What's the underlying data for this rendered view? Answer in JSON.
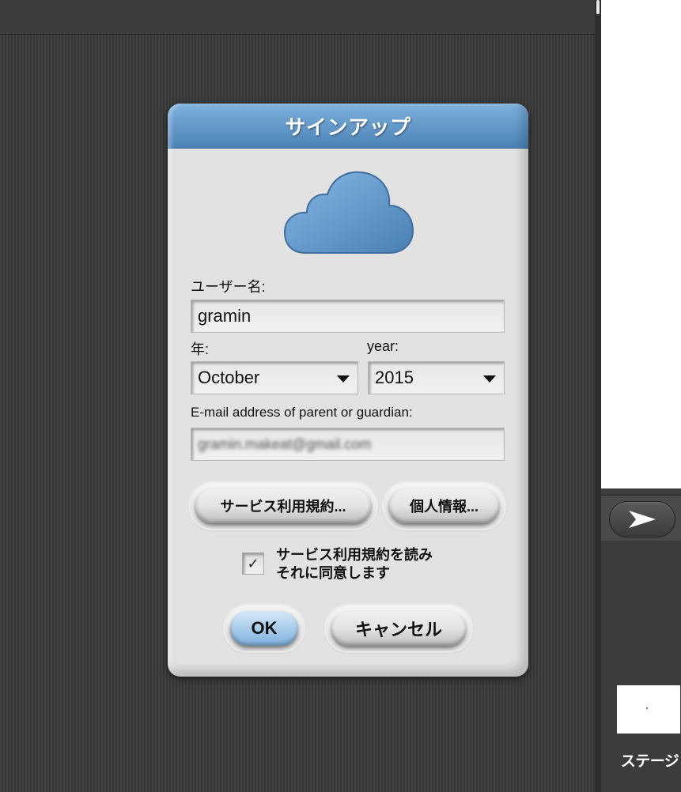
{
  "dialog": {
    "title": "サインアップ",
    "username_label": "ユーザー名:",
    "username_value": "gramin",
    "month_label": "年:",
    "month_value": "October",
    "year_label": "year:",
    "year_value": "2015",
    "email_label": "E-mail address of parent or guardian:",
    "email_value": "gramin.makeat@gmail.com",
    "terms_button": "サービス利用規約...",
    "privacy_button": "個人情報...",
    "agree_line1": "サービス利用規約を読み",
    "agree_line2": "それに同意します",
    "agree_checked": true,
    "check_glyph": "✓",
    "ok_button": "OK",
    "cancel_button": "キャンセル"
  },
  "stage": {
    "label": "ステージ"
  },
  "colors": {
    "header_top": "#7fb1dd",
    "header_bottom": "#4b82b6",
    "cloud": "#5d96cb"
  },
  "icons": {
    "cloud": "cloud-icon",
    "dropdown": "chevron-down-icon",
    "play_arrow": "arrow-right-icon"
  }
}
